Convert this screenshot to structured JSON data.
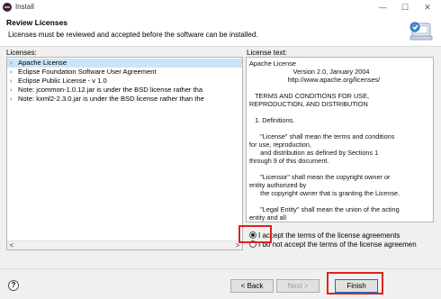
{
  "window": {
    "title": "Install",
    "minimize": "—",
    "maximize": "☐",
    "close": "✕"
  },
  "header": {
    "title": "Review Licenses",
    "description": "Licenses must be reviewed and accepted before the software can be installed."
  },
  "licenses_label": "Licenses:",
  "license_text_label": "License text:",
  "licenses": [
    {
      "label": "Apache License",
      "selected": true
    },
    {
      "label": "Eclipse Foundation Software User Agreement",
      "selected": false
    },
    {
      "label": "Eclipse Public License - v 1.0",
      "selected": false
    },
    {
      "label": "Note:  jcommon-1.0.12.jar is under the BSD license rather tha",
      "selected": false
    },
    {
      "label": "Note:  kxml2-2.3.0.jar is under the BSD license rather than the",
      "selected": false
    }
  ],
  "license_text": "Apache License\n                        Version 2.0, January 2004\n                     http://www.apache.org/licenses/\n\n   TERMS AND CONDITIONS FOR USE,\nREPRODUCTION, AND DISTRIBUTION\n\n   1. Definitions.\n\n      \"License\" shall mean the terms and conditions\nfor use, reproduction,\n      and distribution as defined by Sections 1\nthrough 9 of this document.\n\n      \"Licensor\" shall mean the copyright owner or\nentity authorized by\n      the copyright owner that is granting the License.\n\n      \"Legal Entity\" shall mean the union of the acting\nentity and all\n      other entities that control, are controlled by, or\nare under common",
  "radios": {
    "accept": "I accept the terms of the license agreements",
    "decline": "I do not accept the terms of the license agreemen"
  },
  "buttons": {
    "help": "?",
    "back": "< Back",
    "next": "Next >",
    "finish": "Finish"
  },
  "scroll": {
    "left": "<",
    "right": ">"
  }
}
